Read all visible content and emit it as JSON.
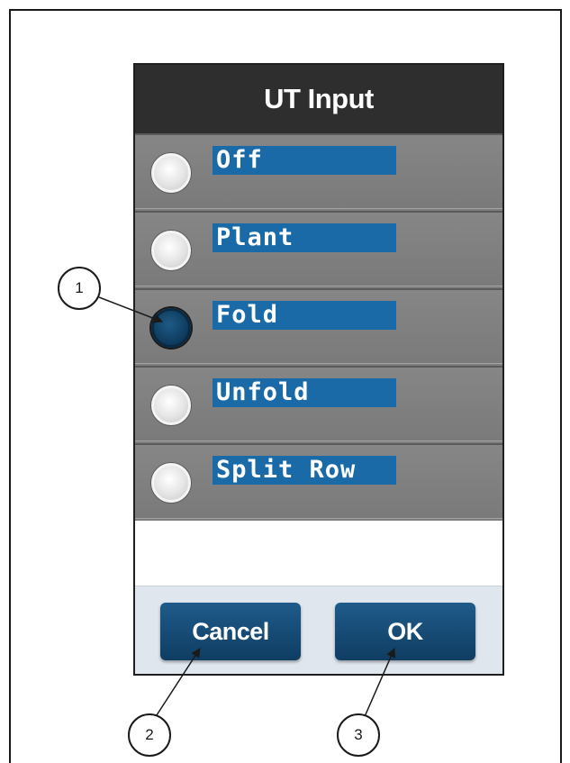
{
  "dialog": {
    "title": "UT Input",
    "options": [
      {
        "label": "Off",
        "selected": false
      },
      {
        "label": "Plant",
        "selected": false
      },
      {
        "label": "Fold",
        "selected": true
      },
      {
        "label": "Unfold",
        "selected": false
      },
      {
        "label": "Split Row",
        "selected": false
      }
    ],
    "buttons": {
      "cancel_label": "Cancel",
      "ok_label": "OK"
    }
  },
  "callouts": [
    "1",
    "2",
    "3"
  ],
  "colors": {
    "header_bg": "#2e2e2e",
    "option_bg": "#7e7e7e",
    "label_highlight": "#1a6aa8",
    "selected_radio": "#0e3a5c",
    "button_bg": "#1f5b8a",
    "button_bar_bg": "#dfe6ee"
  },
  "icons": {
    "radio_unselected": "radio-unselected-icon",
    "radio_selected": "radio-selected-icon"
  }
}
